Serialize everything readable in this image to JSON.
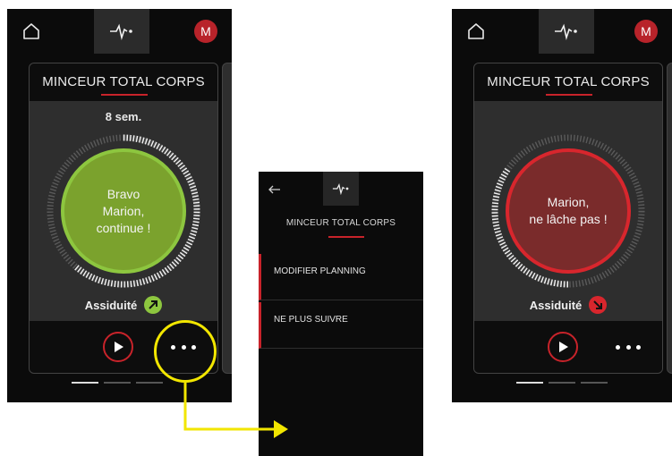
{
  "colors": {
    "accent_red": "#c8232a",
    "green_gauge": "#86b22a",
    "red_gauge": "#c8232a",
    "highlight_yellow": "#f2e600"
  },
  "left_screen": {
    "avatar_initial": "M",
    "card_title": "MINCEUR TOTAL CORPS",
    "weeks": "8 sem.",
    "message_line1": "Bravo",
    "message_line2": "Marion,",
    "message_line3": "continue !",
    "assiduite_label": "Assiduité",
    "trend": "up-right-arrow-icon",
    "progress_fraction": 0.62,
    "active_page": 1,
    "page_count": 3
  },
  "middle_screen": {
    "card_title": "MINCEUR TOTAL CORPS",
    "menu_items": [
      "MODIFIER PLANNING",
      "NE PLUS SUIVRE"
    ]
  },
  "right_screen": {
    "avatar_initial": "M",
    "card_title": "MINCEUR TOTAL CORPS",
    "message_line1": "Marion,",
    "message_line2": "ne lâche pas !",
    "assiduite_label": "Assiduité",
    "trend": "down-right-arrow-icon",
    "progress_fraction": 0.35,
    "active_page": 1,
    "page_count": 3
  }
}
